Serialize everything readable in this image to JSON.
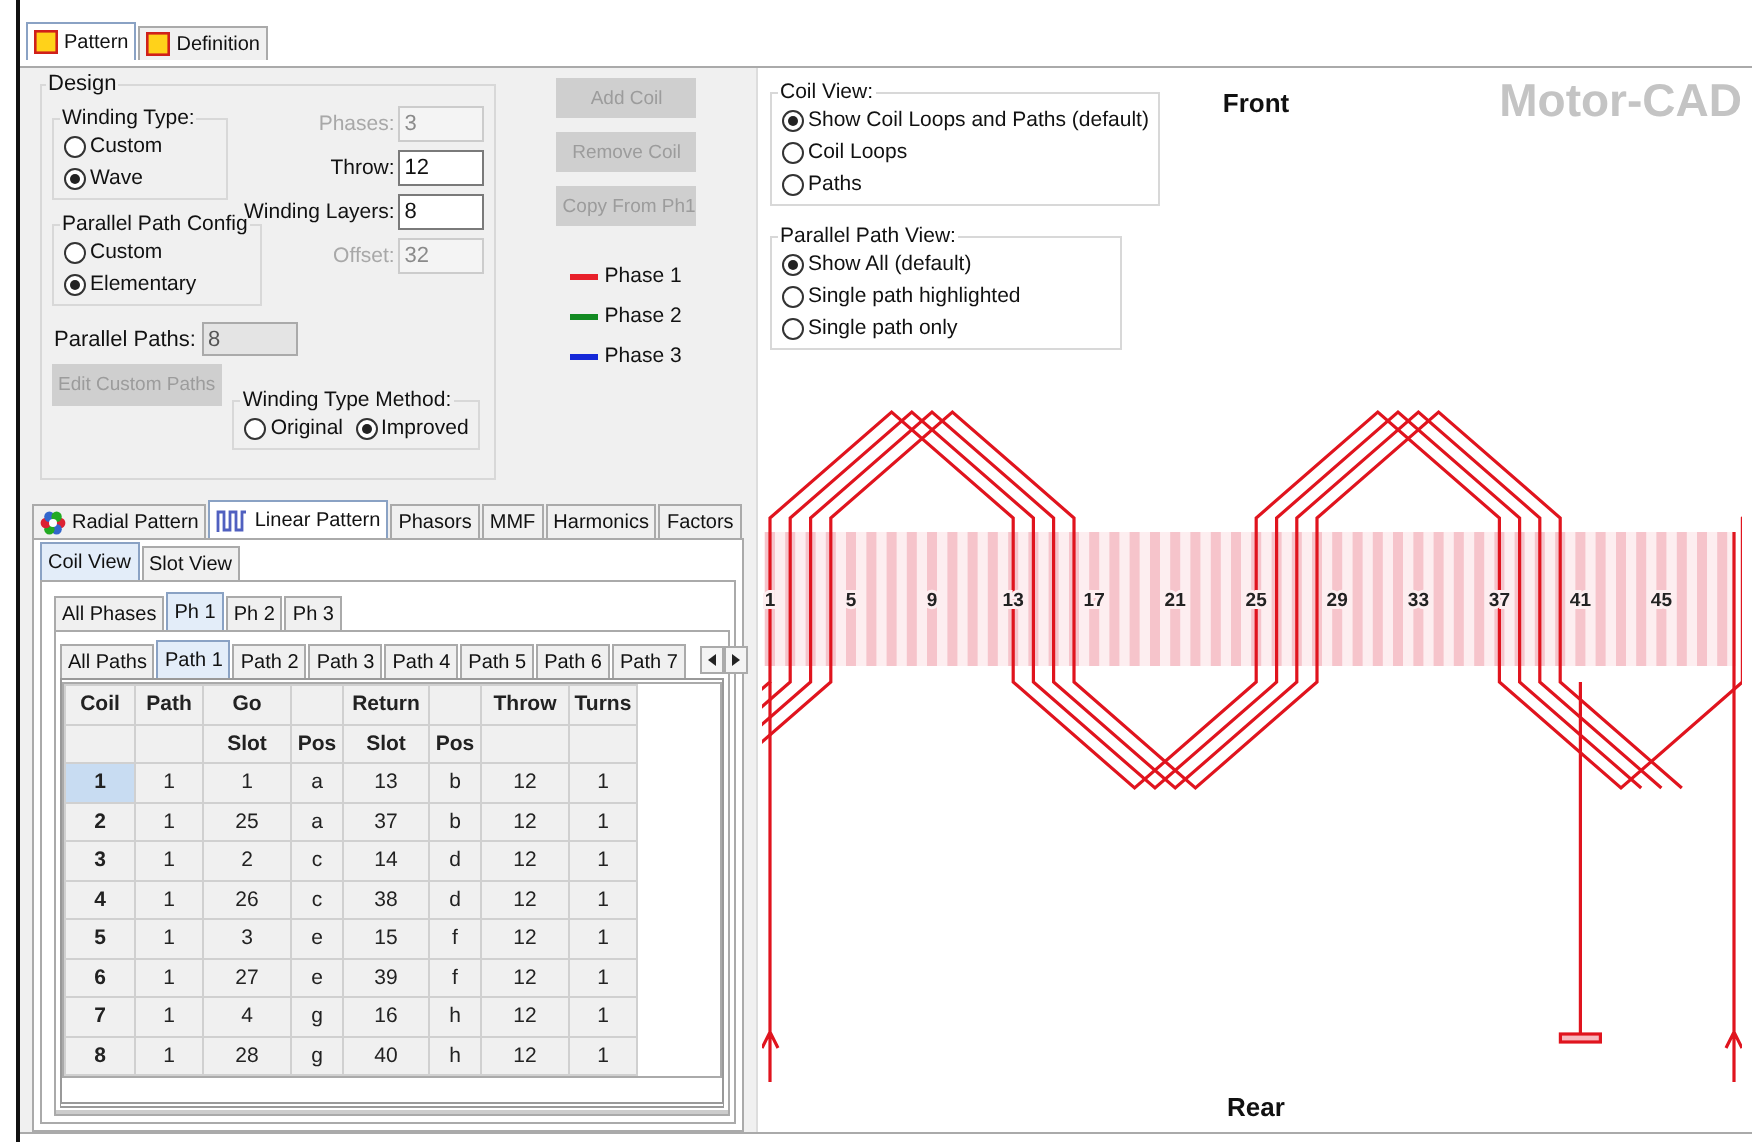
{
  "top_tabs": [
    {
      "label": "Pattern",
      "selected": true
    },
    {
      "label": "Definition",
      "selected": false
    }
  ],
  "design": {
    "title": "Design",
    "winding_type": {
      "title": "Winding Type:",
      "options": [
        {
          "label": "Custom",
          "selected": false
        },
        {
          "label": "Wave",
          "selected": true
        }
      ]
    },
    "parallel_path_config": {
      "title": "Parallel Path Config",
      "options": [
        {
          "label": "Custom",
          "selected": false
        },
        {
          "label": "Elementary",
          "selected": true
        }
      ]
    },
    "fields": [
      {
        "label": "Phases:",
        "value": "3",
        "disabled": true
      },
      {
        "label": "Throw:",
        "value": "12",
        "disabled": false
      },
      {
        "label": "Winding Layers:",
        "value": "8",
        "disabled": false
      },
      {
        "label": "Offset:",
        "value": "32",
        "disabled": true
      }
    ],
    "parallel_paths": {
      "label": "Parallel Paths:",
      "value": "8",
      "disabled": true
    },
    "edit_custom_paths": {
      "label": "Edit Custom Paths",
      "disabled": true
    },
    "winding_type_method": {
      "title": "Winding Type Method:",
      "options": [
        {
          "label": "Original",
          "selected": false
        },
        {
          "label": "Improved",
          "selected": true
        }
      ]
    }
  },
  "coil_buttons": [
    {
      "label": "Add Coil",
      "disabled": true
    },
    {
      "label": "Remove Coil",
      "disabled": true
    },
    {
      "label": "Copy From Ph1",
      "disabled": true
    }
  ],
  "legend": [
    {
      "label": "Phase 1",
      "color": "#e8202a"
    },
    {
      "label": "Phase 2",
      "color": "#128a22"
    },
    {
      "label": "Phase 3",
      "color": "#1428d8"
    }
  ],
  "coil_view": {
    "title": "Coil View:",
    "options": [
      {
        "label": "Show Coil Loops and Paths (default)",
        "selected": true
      },
      {
        "label": "Coil Loops",
        "selected": false
      },
      {
        "label": "Paths",
        "selected": false
      }
    ]
  },
  "parallel_path_view": {
    "title": "Parallel Path View:",
    "options": [
      {
        "label": "Show All (default)",
        "selected": true
      },
      {
        "label": "Single path highlighted",
        "selected": false
      },
      {
        "label": "Single path only",
        "selected": false
      }
    ]
  },
  "view_tabs": [
    {
      "label": "Radial Pattern",
      "selected": false
    },
    {
      "label": "Linear Pattern",
      "selected": true
    },
    {
      "label": "Phasors",
      "selected": false
    },
    {
      "label": "MMF",
      "selected": false
    },
    {
      "label": "Harmonics",
      "selected": false
    },
    {
      "label": "Factors",
      "selected": false
    }
  ],
  "sub_tabs": [
    {
      "label": "Coil View",
      "selected": true
    },
    {
      "label": "Slot View",
      "selected": false
    }
  ],
  "phase_tabs": [
    {
      "label": "All Phases",
      "selected": false
    },
    {
      "label": "Ph 1",
      "selected": true
    },
    {
      "label": "Ph 2",
      "selected": false
    },
    {
      "label": "Ph 3",
      "selected": false
    }
  ],
  "path_tabs": [
    {
      "label": "All Paths",
      "selected": false
    },
    {
      "label": "Path 1",
      "selected": true
    },
    {
      "label": "Path 2",
      "selected": false
    },
    {
      "label": "Path 3",
      "selected": false
    },
    {
      "label": "Path 4",
      "selected": false
    },
    {
      "label": "Path 5",
      "selected": false
    },
    {
      "label": "Path 6",
      "selected": false
    },
    {
      "label": "Path 7",
      "selected": false
    }
  ],
  "table": {
    "columns": [
      {
        "top": "Coil"
      },
      {
        "top": "Path"
      },
      {
        "top": "Go",
        "sub": "Slot"
      },
      {
        "sub": "Pos"
      },
      {
        "top": "Return",
        "sub": "Slot"
      },
      {
        "sub": "Pos"
      },
      {
        "top": "Throw"
      },
      {
        "top": "Turns"
      }
    ],
    "rows": [
      {
        "selected": true,
        "cells": [
          "1",
          "1",
          "1",
          "a",
          "13",
          "b",
          "12",
          "1"
        ]
      },
      {
        "selected": false,
        "cells": [
          "2",
          "1",
          "25",
          "a",
          "37",
          "b",
          "12",
          "1"
        ]
      },
      {
        "selected": false,
        "cells": [
          "3",
          "1",
          "2",
          "c",
          "14",
          "d",
          "12",
          "1"
        ]
      },
      {
        "selected": false,
        "cells": [
          "4",
          "1",
          "26",
          "c",
          "38",
          "d",
          "12",
          "1"
        ]
      },
      {
        "selected": false,
        "cells": [
          "5",
          "1",
          "3",
          "e",
          "15",
          "f",
          "12",
          "1"
        ]
      },
      {
        "selected": false,
        "cells": [
          "6",
          "1",
          "27",
          "e",
          "39",
          "f",
          "12",
          "1"
        ]
      },
      {
        "selected": false,
        "cells": [
          "7",
          "1",
          "4",
          "g",
          "16",
          "h",
          "12",
          "1"
        ]
      },
      {
        "selected": false,
        "cells": [
          "8",
          "1",
          "28",
          "g",
          "40",
          "h",
          "12",
          "1"
        ]
      }
    ]
  },
  "diagram": {
    "front_label": "Front",
    "rear_label": "Rear",
    "logo": "Motor-CAD",
    "slot_labels": [
      "1",
      "5",
      "9",
      "13",
      "17",
      "21",
      "25",
      "29",
      "33",
      "37",
      "41",
      "45"
    ]
  }
}
